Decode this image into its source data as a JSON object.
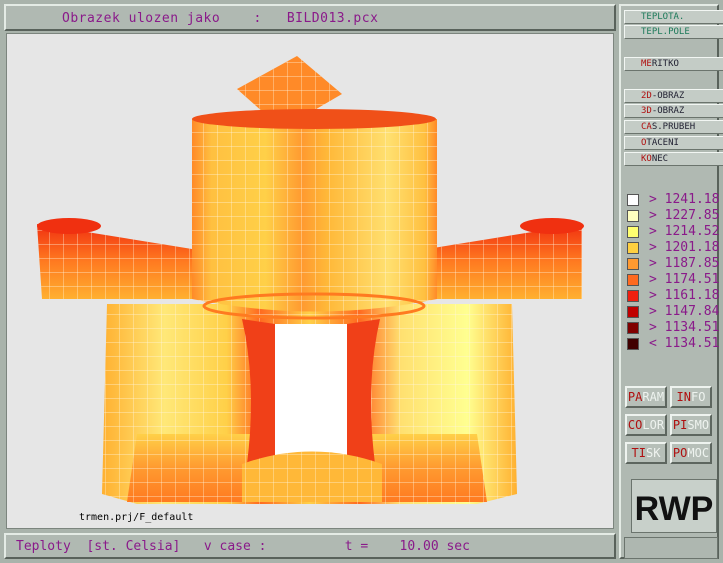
{
  "title": {
    "text": "Obrazek ulozen jako    :   BILD013.pcx"
  },
  "viewport": {
    "project_label": "trmen.prj/F_default"
  },
  "status": {
    "text": "Teploty  [st. Celsia]   v case :          t =    10.00 sec"
  },
  "menu": [
    {
      "hot": "TE",
      "rest": "PLOTA.",
      "active": true
    },
    {
      "hot": "TE",
      "rest": "PL.POLE",
      "active": true
    },
    {
      "hot": "ME",
      "rest": "RITKO",
      "active": false
    },
    {
      "hot": "2D",
      "rest": "-OBRAZ",
      "active": false
    },
    {
      "hot": "3D",
      "rest": "-OBRAZ",
      "active": false
    },
    {
      "hot": "CA",
      "rest": "S.PRUBEH",
      "active": false
    },
    {
      "hot": "O",
      "rest": "TACENI",
      "active": false
    },
    {
      "hot": "KO",
      "rest": "NEC",
      "active": false
    }
  ],
  "legend": [
    {
      "label": "> 1241.18",
      "color": "#ffffff"
    },
    {
      "label": "> 1227.85",
      "color": "#ffffc0"
    },
    {
      "label": "> 1214.52",
      "color": "#ffff70"
    },
    {
      "label": "> 1201.18",
      "color": "#ffd040"
    },
    {
      "label": "> 1187.85",
      "color": "#ff9a30"
    },
    {
      "label": "> 1174.51",
      "color": "#ff6a20"
    },
    {
      "label": "> 1161.18",
      "color": "#f02010"
    },
    {
      "label": "> 1147.84",
      "color": "#c00000"
    },
    {
      "label": "> 1134.51",
      "color": "#800000"
    },
    {
      "label": "< 1134.51",
      "color": "#400000"
    }
  ],
  "tools": [
    {
      "hot": "PA",
      "rest": "RAM",
      "name": "param-button"
    },
    {
      "hot": "IN",
      "rest": "FO",
      "name": "info-button"
    },
    {
      "hot": "CO",
      "rest": "LOR",
      "name": "color-button"
    },
    {
      "hot": "PI",
      "rest": "SMO",
      "name": "pismo-button"
    },
    {
      "hot": "TI",
      "rest": "SK",
      "name": "tisk-button"
    },
    {
      "hot": "PO",
      "rest": "MOC",
      "name": "pomoc-button"
    }
  ],
  "logo": {
    "text": "RWP"
  }
}
